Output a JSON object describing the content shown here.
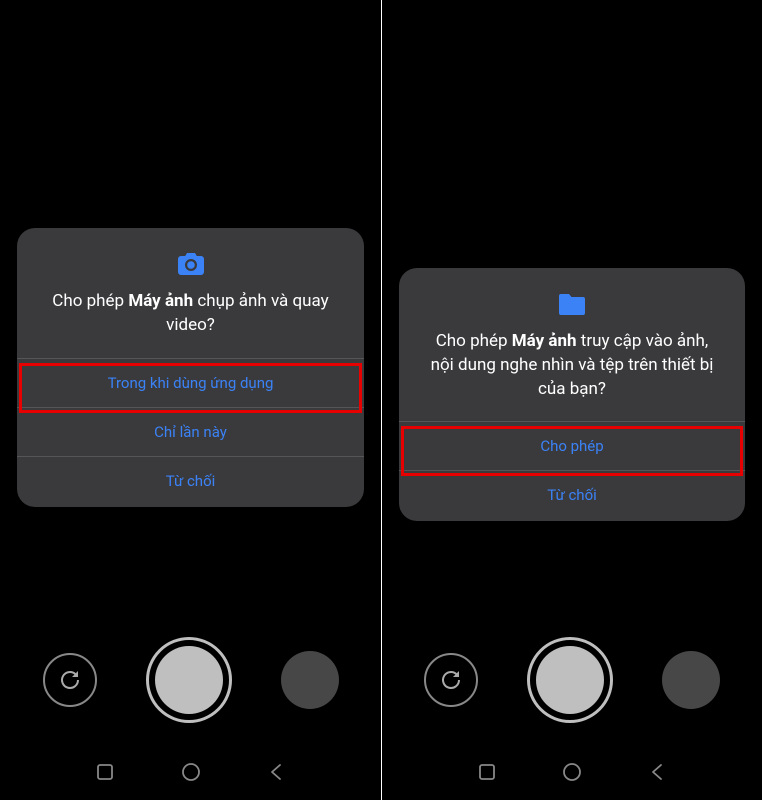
{
  "screens": {
    "left": {
      "icon": "camera",
      "message_prefix": "Cho phép ",
      "message_bold": "Máy ảnh",
      "message_suffix": " chụp ảnh và quay video?",
      "buttons": {
        "primary": "Trong khi dùng ứng dụng",
        "secondary": "Chỉ lần này",
        "deny": "Từ chối"
      },
      "highlighted_button": "primary"
    },
    "right": {
      "icon": "folder",
      "message_prefix": "Cho phép ",
      "message_bold": "Máy ảnh",
      "message_suffix": " truy cập vào ảnh, nội dung nghe nhìn và tệp trên thiết bị của bạn?",
      "buttons": {
        "allow": "Cho phép",
        "deny": "Từ chối"
      },
      "highlighted_button": "allow"
    }
  },
  "colors": {
    "dialog_bg": "#3a3a3c",
    "button_text": "#3b82f6",
    "highlight": "#e60000",
    "shutter": "#bfbfbf"
  }
}
